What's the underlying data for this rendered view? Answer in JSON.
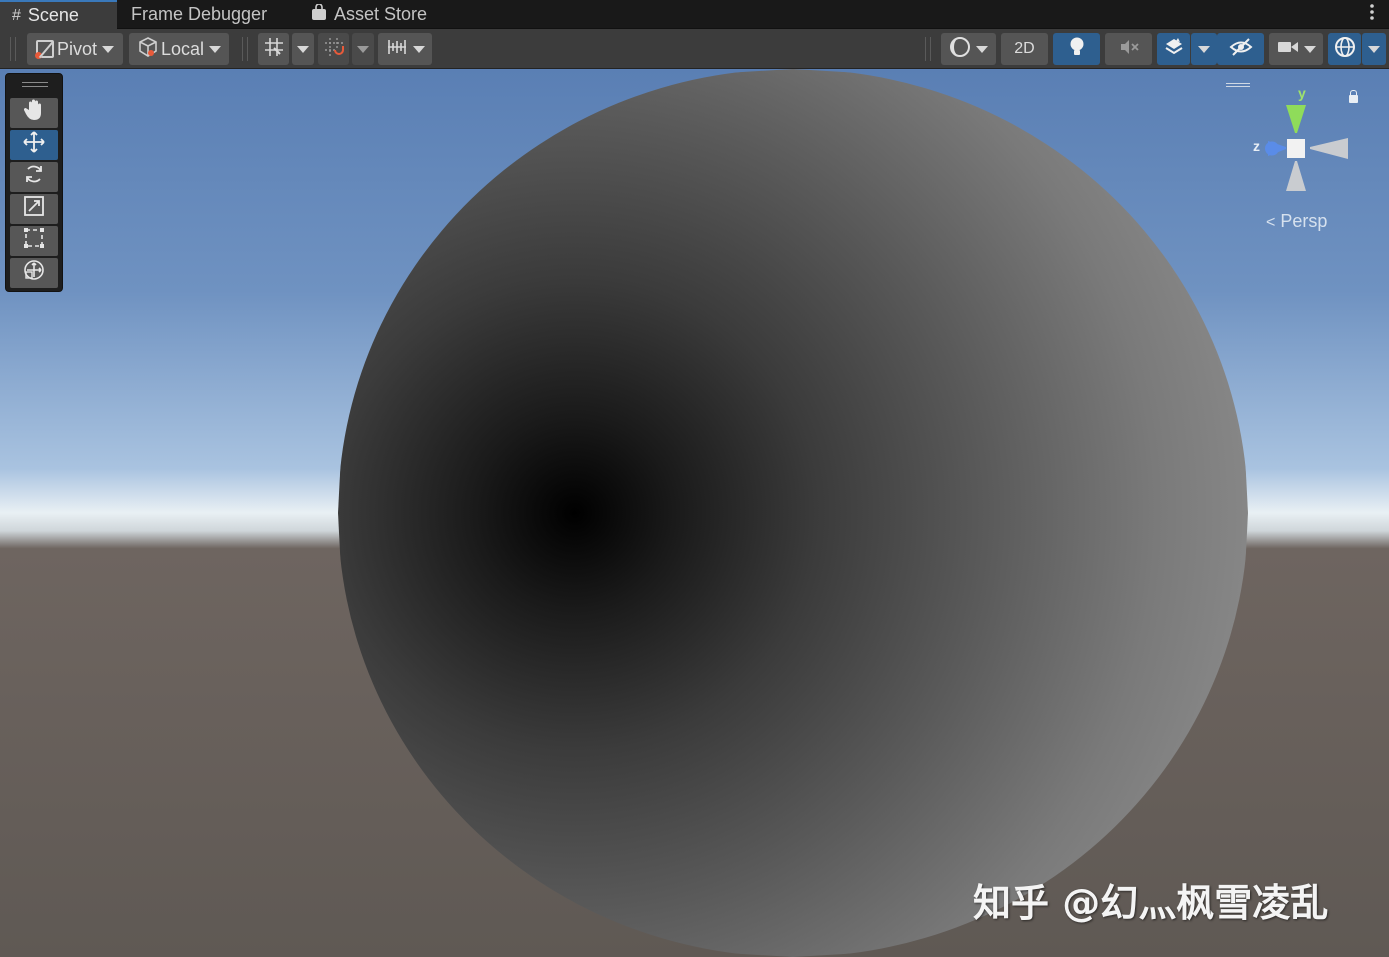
{
  "tabs": [
    {
      "label": "Scene",
      "icon": "grid-icon",
      "active": true
    },
    {
      "label": "Frame Debugger",
      "active": false
    },
    {
      "label": "Asset Store",
      "icon": "shopping-bag-icon",
      "active": false
    }
  ],
  "toolbar": {
    "pivot_label": "Pivot",
    "local_label": "Local",
    "mode_2d_label": "2D"
  },
  "tools": [
    {
      "name": "hand-tool",
      "icon": "hand-icon",
      "selected": false
    },
    {
      "name": "move-tool",
      "icon": "move-icon",
      "selected": true
    },
    {
      "name": "rotate-tool",
      "icon": "rotate-icon",
      "selected": false
    },
    {
      "name": "scale-tool",
      "icon": "scale-icon",
      "selected": false
    },
    {
      "name": "rect-tool",
      "icon": "rect-icon",
      "selected": false
    },
    {
      "name": "transform-tool",
      "icon": "transform-icon",
      "selected": false
    }
  ],
  "gizmo": {
    "y_label": "y",
    "z_label": "z",
    "projection_label": "Persp"
  },
  "watermark": "知乎 @幻灬枫雪凌乱",
  "colors": {
    "accent": "#2e5f8f",
    "tab_active_bar": "#3a79bb",
    "sky_top": "#5a7fb4",
    "ground": "#5f5954"
  }
}
